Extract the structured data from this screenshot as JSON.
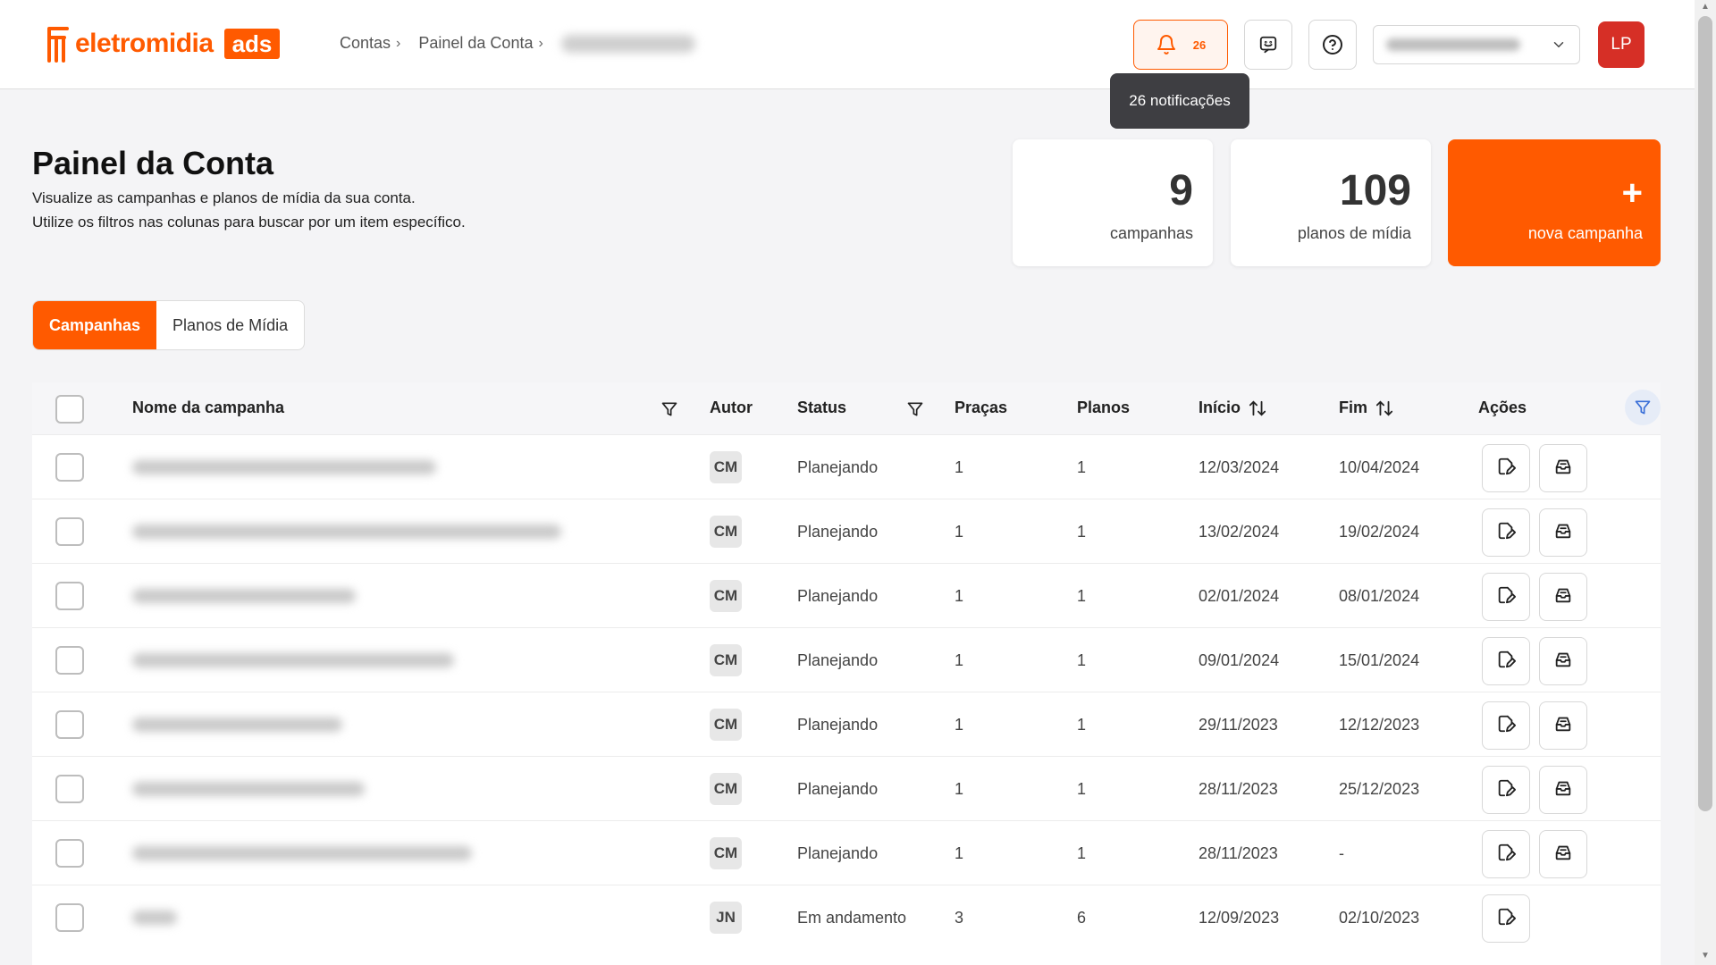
{
  "header": {
    "logo_text": "eletromidia",
    "logo_badge": "ads",
    "breadcrumb": [
      "Contas",
      "Painel da Conta"
    ],
    "notifications_count": "26",
    "notifications_tooltip": "26 notificações",
    "avatar_initials": "LP"
  },
  "page": {
    "title": "Painel da Conta",
    "subtitle_line1": "Visualize as campanhas e planos de mídia da sua conta.",
    "subtitle_line2": "Utilize os filtros nas colunas para buscar por um item específico."
  },
  "stats": {
    "campaigns_value": "9",
    "campaigns_label": "campanhas",
    "plans_value": "109",
    "plans_label": "planos de mídia",
    "new_campaign_plus": "+",
    "new_campaign_label": "nova campanha"
  },
  "tabs": [
    {
      "label": "Campanhas",
      "active": true
    },
    {
      "label": "Planos de Mídia",
      "active": false
    }
  ],
  "table": {
    "columns": {
      "name": "Nome da campanha",
      "author": "Autor",
      "status": "Status",
      "pracas": "Praças",
      "planos": "Planos",
      "inicio": "Início",
      "fim": "Fim",
      "acoes": "Ações"
    },
    "rows": [
      {
        "author": "CM",
        "status": "Planejando",
        "pracas": "1",
        "planos": "1",
        "inicio": "12/03/2024",
        "fim": "10/04/2024",
        "actions": 2
      },
      {
        "author": "CM",
        "status": "Planejando",
        "pracas": "1",
        "planos": "1",
        "inicio": "13/02/2024",
        "fim": "19/02/2024",
        "actions": 2
      },
      {
        "author": "CM",
        "status": "Planejando",
        "pracas": "1",
        "planos": "1",
        "inicio": "02/01/2024",
        "fim": "08/01/2024",
        "actions": 2
      },
      {
        "author": "CM",
        "status": "Planejando",
        "pracas": "1",
        "planos": "1",
        "inicio": "09/01/2024",
        "fim": "15/01/2024",
        "actions": 2
      },
      {
        "author": "CM",
        "status": "Planejando",
        "pracas": "1",
        "planos": "1",
        "inicio": "29/11/2023",
        "fim": "12/12/2023",
        "actions": 2
      },
      {
        "author": "CM",
        "status": "Planejando",
        "pracas": "1",
        "planos": "1",
        "inicio": "28/11/2023",
        "fim": "25/12/2023",
        "actions": 2
      },
      {
        "author": "CM",
        "status": "Planejando",
        "pracas": "1",
        "planos": "1",
        "inicio": "28/11/2023",
        "fim": "-",
        "actions": 2
      },
      {
        "author": "JN",
        "status": "Em andamento",
        "pracas": "3",
        "planos": "6",
        "inicio": "12/09/2023",
        "fim": "02/10/2023",
        "actions": 1
      }
    ]
  },
  "colors": {
    "brand": "#ff5a00",
    "avatar": "#d62f26",
    "tooltip": "#3e3e42"
  },
  "icons": [
    "bell-icon",
    "chat-icon",
    "help-icon",
    "chevron-down-icon",
    "filter-icon",
    "sort-icon",
    "edit-icon",
    "inbox-icon"
  ]
}
